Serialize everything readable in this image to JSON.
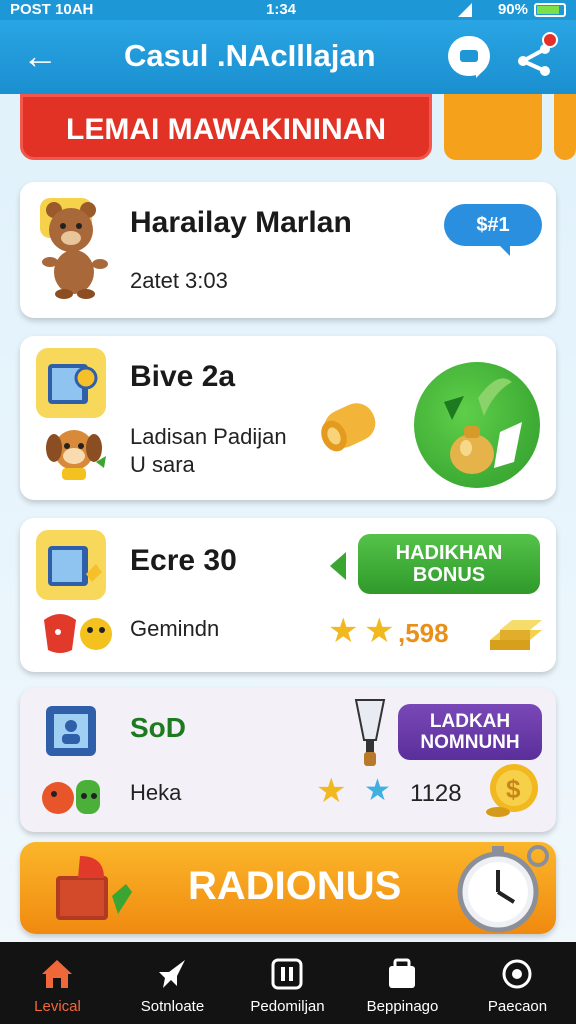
{
  "status_bar": {
    "left": "POST 10AH",
    "time": "1:34",
    "battery": "90%"
  },
  "app_bar": {
    "title": "Casul .NAcIllajan"
  },
  "top_tab": {
    "label": "LEMAI MAWAKININAN"
  },
  "cards": [
    {
      "title": "Harailay Marlan",
      "subtitle": "2atet 3:03",
      "badge": "$#1"
    },
    {
      "title": "Bive 2a",
      "subtitle_line1": "Ladisan Padijan",
      "subtitle_line2": "U sara"
    },
    {
      "title": "Ecre 30",
      "subtitle": "Gemindn",
      "button_line1": "HADIKHAN",
      "button_line2": "BONUS",
      "score": ",598"
    },
    {
      "title": "SoD",
      "subtitle": "Heka",
      "button_line1": "LADKAH",
      "button_line2": "NOMNUNH",
      "score": "1128"
    }
  ],
  "bonus_banner": {
    "label": "RADIONUS"
  },
  "bottom_nav": [
    {
      "label": "Levical",
      "icon": "home-icon",
      "active": true
    },
    {
      "label": "Sotnloate",
      "icon": "rocket-icon",
      "active": false
    },
    {
      "label": "Pedomiljan",
      "icon": "pause-icon",
      "active": false
    },
    {
      "label": "Beppinago",
      "icon": "bag-icon",
      "active": false
    },
    {
      "label": "Paecaon",
      "icon": "target-icon",
      "active": false
    }
  ],
  "colors": {
    "primary": "#1e97d6",
    "accent_red": "#e13225",
    "accent_orange": "#f6a11c",
    "green": "#3aa631",
    "purple": "#6b3aa8",
    "nav_active": "#f0683a"
  }
}
